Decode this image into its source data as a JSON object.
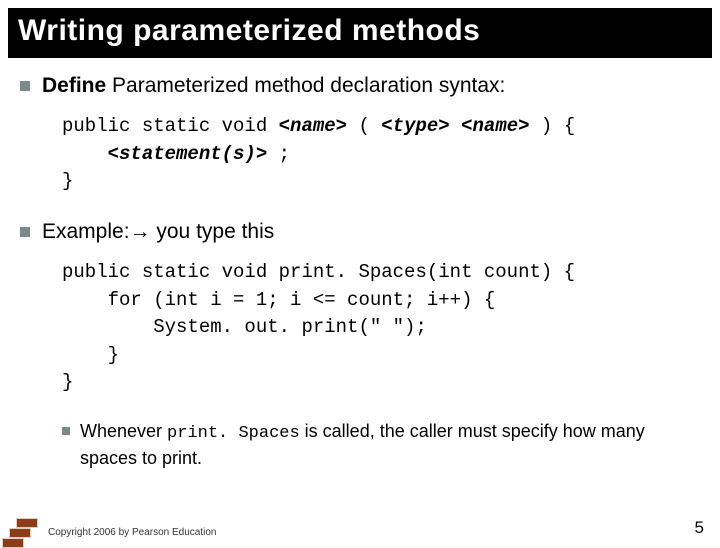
{
  "title": "Writing parameterized methods",
  "bullet1": {
    "bold": "Define",
    "rest": " Parameterized method declaration syntax:"
  },
  "syntax": {
    "line1_a": "public static void ",
    "line1_name1": "<name>",
    "line1_b": " ( ",
    "line1_type": "<type>",
    "line1_c": " ",
    "line1_name2": "<name>",
    "line1_d": " ) {",
    "line2_a": "    ",
    "line2_stmt": "<statement(s)>",
    "line2_b": " ;",
    "line3": "}"
  },
  "bullet2": {
    "a": "Example:",
    "arrow": "→",
    "b": " you type this"
  },
  "example": {
    "l1": "public static void print. Spaces(int count) {",
    "l2": "    for (int i = 1; i <= count; i++) {",
    "l3": "        System. out. print(\" \");",
    "l4": "    }",
    "l5": "}"
  },
  "sub": {
    "a": "Whenever ",
    "code": "print. Spaces",
    "b": " is called, the caller must specify how many spaces to print."
  },
  "copyright": "Copyright 2006 by Pearson Education",
  "page": "5"
}
